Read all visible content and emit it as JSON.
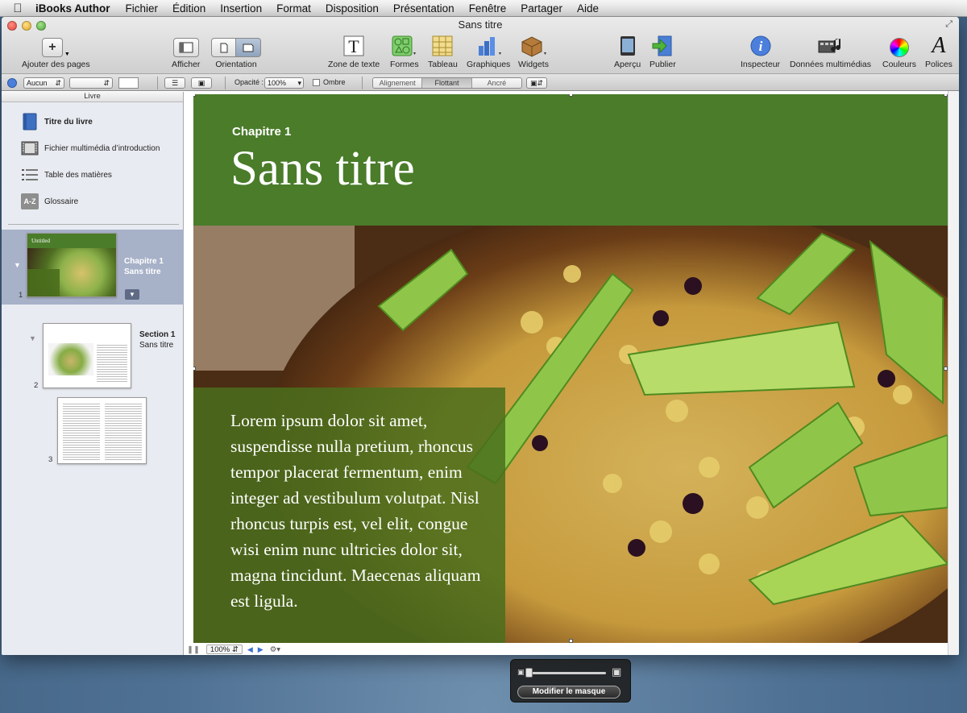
{
  "menubar": {
    "app_name": "iBooks Author",
    "items": [
      "Fichier",
      "Édition",
      "Insertion",
      "Format",
      "Disposition",
      "Présentation",
      "Fenêtre",
      "Partager",
      "Aide"
    ]
  },
  "window": {
    "title": "Sans titre"
  },
  "toolbar": {
    "add_pages": "Ajouter des pages",
    "view": "Afficher",
    "orientation": "Orientation",
    "text_box": "Zone de texte",
    "shapes": "Formes",
    "table": "Tableau",
    "charts": "Graphiques",
    "widgets": "Widgets",
    "preview": "Aperçu",
    "publish": "Publier",
    "inspector": "Inspecteur",
    "media": "Données multimédias",
    "colors": "Couleurs",
    "fonts": "Polices"
  },
  "formatbar": {
    "wrap_select": "Aucun",
    "opacity_label": "Opacité :",
    "opacity_value": "100%",
    "shadow_label": "Ombre",
    "align_options": [
      "Alignement",
      "Flottant",
      "Ancré"
    ]
  },
  "sidebar": {
    "header": "Livre",
    "items": [
      "Titre du livre",
      "Fichier multimédia d’introduction",
      "Table des matières",
      "Glossaire"
    ],
    "pages": [
      {
        "num": "1",
        "label_line1": "Chapitre 1",
        "label_line2": "Sans titre",
        "thumb_title": "Untitled"
      },
      {
        "num": "2",
        "label_line1": "Section 1",
        "label_line2": "Sans titre"
      },
      {
        "num": "3"
      }
    ]
  },
  "page": {
    "chapter": "Chapitre 1",
    "title": "Sans titre",
    "body": "Lorem ipsum dolor sit amet, suspendisse nulla pretium, rhoncus tempor placerat fermentum, enim integer ad vestibulum volutpat. Nisl rhoncus turpis est, vel elit, congue wisi enim nunc ultricies dolor sit, magna tincidunt. Maecenas aliquam est ligula."
  },
  "statusbar": {
    "zoom": "100%"
  },
  "hud": {
    "button": "Modifier le masque"
  },
  "colors": {
    "accent_green": "#4a7c2a",
    "selection": "#a7b1c8"
  }
}
